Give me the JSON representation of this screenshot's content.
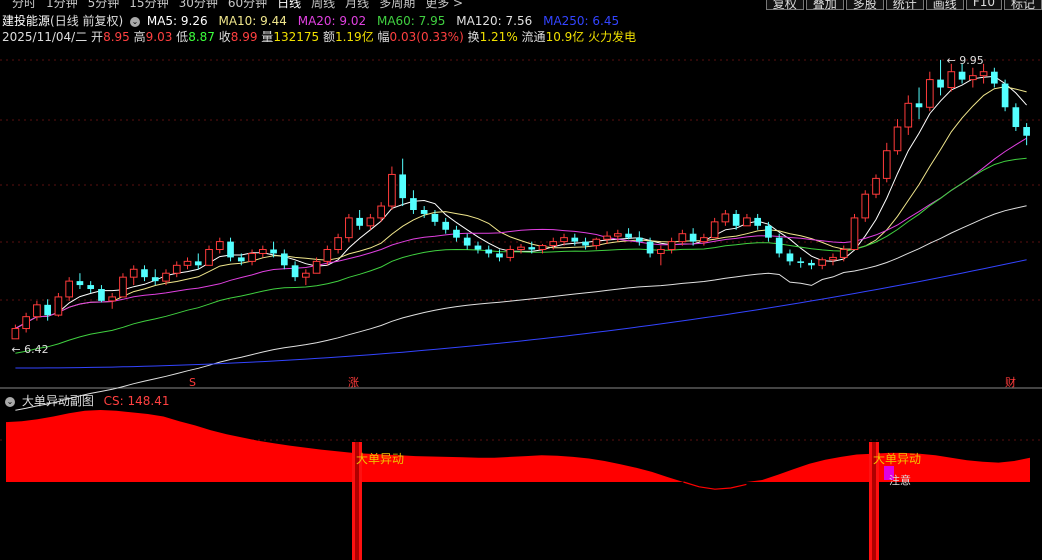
{
  "nav": {
    "periods": [
      "分时",
      "1分钟",
      "5分钟",
      "15分钟",
      "30分钟",
      "60分钟",
      "日线",
      "周线",
      "月线",
      "多周期",
      "更多 >"
    ],
    "selected_period": "日线",
    "buttons": [
      "复权",
      "叠加",
      "多股",
      "统计",
      "画线",
      "F10",
      "标记"
    ]
  },
  "stock": {
    "name": "建投能源",
    "mode": "(日线 前复权)",
    "date": "2025/11/04/二",
    "open_label": "开",
    "open": "8.95",
    "high_label": "高",
    "high": "9.03",
    "low_label": "低",
    "low": "8.87",
    "close_label": "收",
    "close": "8.99",
    "volume_label": "量",
    "volume": "132175",
    "amount_label": "额",
    "amount": "1.19亿",
    "change_label": "幅",
    "change": "0.03(0.33%)",
    "turnover_label": "换",
    "turnover": "1.21%",
    "float_label": "流通",
    "float": "10.9亿",
    "sector": "火力发电"
  },
  "ma": [
    {
      "label": "MA5: 9.26",
      "color": "#ffffff"
    },
    {
      "label": "MA10: 9.44",
      "color": "#f0e68c"
    },
    {
      "label": "MA20: 9.02",
      "color": "#e040e0"
    },
    {
      "label": "MA60: 7.95",
      "color": "#40d040"
    },
    {
      "label": "MA120: 7.56",
      "color": "#e0e0e0"
    },
    {
      "label": "MA250: 6.45",
      "color": "#3344ff"
    }
  ],
  "annotations": {
    "high": "9.95",
    "low": "6.42",
    "marker_s": "S",
    "marker_zhang": "涨",
    "marker_cai": "财"
  },
  "indicator": {
    "name": "大单异动副图",
    "value_label": "CS: 148.41",
    "signal": "大单异动",
    "attention": "注意"
  },
  "colors": {
    "up": "#ff3b3b",
    "down": "#54ffff",
    "ma5": "#ffffff",
    "ma10": "#f0e68c",
    "ma20": "#e040e0",
    "ma60": "#40d040",
    "ma120": "#e0e0e0",
    "ma250": "#3344ff",
    "fill": "#ff0000"
  },
  "chart_data": {
    "type": "candlestick",
    "x_label": "",
    "y_label": "",
    "ylim": [
      6.0,
      10.1
    ],
    "grid": true,
    "candles": [
      {
        "o": 6.42,
        "h": 6.6,
        "l": 6.42,
        "c": 6.55
      },
      {
        "o": 6.55,
        "h": 6.75,
        "l": 6.5,
        "c": 6.7
      },
      {
        "o": 6.7,
        "h": 6.9,
        "l": 6.65,
        "c": 6.85
      },
      {
        "o": 6.85,
        "h": 6.92,
        "l": 6.65,
        "c": 6.72
      },
      {
        "o": 6.72,
        "h": 7.0,
        "l": 6.7,
        "c": 6.95
      },
      {
        "o": 6.95,
        "h": 7.2,
        "l": 6.9,
        "c": 7.15
      },
      {
        "o": 7.15,
        "h": 7.25,
        "l": 7.05,
        "c": 7.1
      },
      {
        "o": 7.1,
        "h": 7.15,
        "l": 7.0,
        "c": 7.05
      },
      {
        "o": 7.05,
        "h": 7.1,
        "l": 6.88,
        "c": 6.9
      },
      {
        "o": 6.9,
        "h": 7.0,
        "l": 6.8,
        "c": 6.95
      },
      {
        "o": 6.95,
        "h": 7.25,
        "l": 6.95,
        "c": 7.2
      },
      {
        "o": 7.2,
        "h": 7.35,
        "l": 7.1,
        "c": 7.3
      },
      {
        "o": 7.3,
        "h": 7.35,
        "l": 7.15,
        "c": 7.2
      },
      {
        "o": 7.2,
        "h": 7.3,
        "l": 7.1,
        "c": 7.15
      },
      {
        "o": 7.15,
        "h": 7.3,
        "l": 7.1,
        "c": 7.25
      },
      {
        "o": 7.25,
        "h": 7.4,
        "l": 7.2,
        "c": 7.35
      },
      {
        "o": 7.35,
        "h": 7.45,
        "l": 7.3,
        "c": 7.4
      },
      {
        "o": 7.4,
        "h": 7.5,
        "l": 7.3,
        "c": 7.35
      },
      {
        "o": 7.35,
        "h": 7.6,
        "l": 7.35,
        "c": 7.55
      },
      {
        "o": 7.55,
        "h": 7.7,
        "l": 7.5,
        "c": 7.65
      },
      {
        "o": 7.65,
        "h": 7.7,
        "l": 7.4,
        "c": 7.45
      },
      {
        "o": 7.45,
        "h": 7.5,
        "l": 7.35,
        "c": 7.4
      },
      {
        "o": 7.4,
        "h": 7.55,
        "l": 7.35,
        "c": 7.5
      },
      {
        "o": 7.5,
        "h": 7.6,
        "l": 7.45,
        "c": 7.55
      },
      {
        "o": 7.55,
        "h": 7.65,
        "l": 7.45,
        "c": 7.5
      },
      {
        "o": 7.5,
        "h": 7.55,
        "l": 7.3,
        "c": 7.35
      },
      {
        "o": 7.35,
        "h": 7.4,
        "l": 7.15,
        "c": 7.2
      },
      {
        "o": 7.2,
        "h": 7.3,
        "l": 7.1,
        "c": 7.25
      },
      {
        "o": 7.25,
        "h": 7.45,
        "l": 7.25,
        "c": 7.4
      },
      {
        "o": 7.4,
        "h": 7.6,
        "l": 7.35,
        "c": 7.55
      },
      {
        "o": 7.55,
        "h": 7.75,
        "l": 7.5,
        "c": 7.7
      },
      {
        "o": 7.7,
        "h": 8.0,
        "l": 7.65,
        "c": 7.95
      },
      {
        "o": 7.95,
        "h": 8.05,
        "l": 7.8,
        "c": 7.85
      },
      {
        "o": 7.85,
        "h": 8.0,
        "l": 7.8,
        "c": 7.95
      },
      {
        "o": 7.95,
        "h": 8.15,
        "l": 7.9,
        "c": 8.1
      },
      {
        "o": 8.1,
        "h": 8.6,
        "l": 8.05,
        "c": 8.5
      },
      {
        "o": 8.5,
        "h": 8.7,
        "l": 8.1,
        "c": 8.2
      },
      {
        "o": 8.2,
        "h": 8.3,
        "l": 8.0,
        "c": 8.05
      },
      {
        "o": 8.05,
        "h": 8.1,
        "l": 7.95,
        "c": 8.0
      },
      {
        "o": 8.0,
        "h": 8.05,
        "l": 7.85,
        "c": 7.9
      },
      {
        "o": 7.9,
        "h": 7.95,
        "l": 7.75,
        "c": 7.8
      },
      {
        "o": 7.8,
        "h": 7.85,
        "l": 7.65,
        "c": 7.7
      },
      {
        "o": 7.7,
        "h": 7.75,
        "l": 7.55,
        "c": 7.6
      },
      {
        "o": 7.6,
        "h": 7.65,
        "l": 7.5,
        "c": 7.55
      },
      {
        "o": 7.55,
        "h": 7.6,
        "l": 7.45,
        "c": 7.5
      },
      {
        "o": 7.5,
        "h": 7.55,
        "l": 7.4,
        "c": 7.45
      },
      {
        "o": 7.45,
        "h": 7.6,
        "l": 7.4,
        "c": 7.55
      },
      {
        "o": 7.55,
        "h": 7.62,
        "l": 7.5,
        "c": 7.58
      },
      {
        "o": 7.58,
        "h": 7.65,
        "l": 7.5,
        "c": 7.55
      },
      {
        "o": 7.55,
        "h": 7.62,
        "l": 7.5,
        "c": 7.6
      },
      {
        "o": 7.6,
        "h": 7.7,
        "l": 7.55,
        "c": 7.65
      },
      {
        "o": 7.65,
        "h": 7.75,
        "l": 7.6,
        "c": 7.7
      },
      {
        "o": 7.7,
        "h": 7.75,
        "l": 7.6,
        "c": 7.65
      },
      {
        "o": 7.65,
        "h": 7.7,
        "l": 7.55,
        "c": 7.6
      },
      {
        "o": 7.6,
        "h": 7.7,
        "l": 7.55,
        "c": 7.68
      },
      {
        "o": 7.68,
        "h": 7.78,
        "l": 7.62,
        "c": 7.72
      },
      {
        "o": 7.72,
        "h": 7.8,
        "l": 7.65,
        "c": 7.75
      },
      {
        "o": 7.75,
        "h": 7.82,
        "l": 7.68,
        "c": 7.7
      },
      {
        "o": 7.7,
        "h": 7.78,
        "l": 7.6,
        "c": 7.65
      },
      {
        "o": 7.65,
        "h": 7.7,
        "l": 7.45,
        "c": 7.5
      },
      {
        "o": 7.5,
        "h": 7.6,
        "l": 7.35,
        "c": 7.55
      },
      {
        "o": 7.55,
        "h": 7.7,
        "l": 7.5,
        "c": 7.65
      },
      {
        "o": 7.65,
        "h": 7.8,
        "l": 7.6,
        "c": 7.75
      },
      {
        "o": 7.75,
        "h": 7.82,
        "l": 7.6,
        "c": 7.65
      },
      {
        "o": 7.65,
        "h": 7.75,
        "l": 7.6,
        "c": 7.7
      },
      {
        "o": 7.7,
        "h": 7.95,
        "l": 7.7,
        "c": 7.9
      },
      {
        "o": 7.9,
        "h": 8.05,
        "l": 7.85,
        "c": 8.0
      },
      {
        "o": 8.0,
        "h": 8.05,
        "l": 7.8,
        "c": 7.85
      },
      {
        "o": 7.85,
        "h": 8.0,
        "l": 7.85,
        "c": 7.95
      },
      {
        "o": 7.95,
        "h": 8.0,
        "l": 7.8,
        "c": 7.85
      },
      {
        "o": 7.85,
        "h": 7.9,
        "l": 7.65,
        "c": 7.7
      },
      {
        "o": 7.7,
        "h": 7.75,
        "l": 7.45,
        "c": 7.5
      },
      {
        "o": 7.5,
        "h": 7.55,
        "l": 7.35,
        "c": 7.4
      },
      {
        "o": 7.4,
        "h": 7.45,
        "l": 7.32,
        "c": 7.38
      },
      {
        "o": 7.38,
        "h": 7.42,
        "l": 7.3,
        "c": 7.35
      },
      {
        "o": 7.35,
        "h": 7.45,
        "l": 7.3,
        "c": 7.42
      },
      {
        "o": 7.42,
        "h": 7.5,
        "l": 7.35,
        "c": 7.45
      },
      {
        "o": 7.45,
        "h": 7.6,
        "l": 7.4,
        "c": 7.55
      },
      {
        "o": 7.55,
        "h": 8.0,
        "l": 7.55,
        "c": 7.95
      },
      {
        "o": 7.95,
        "h": 8.3,
        "l": 7.9,
        "c": 8.25
      },
      {
        "o": 8.25,
        "h": 8.5,
        "l": 8.2,
        "c": 8.45
      },
      {
        "o": 8.45,
        "h": 8.9,
        "l": 8.4,
        "c": 8.8
      },
      {
        "o": 8.8,
        "h": 9.2,
        "l": 8.75,
        "c": 9.1
      },
      {
        "o": 9.1,
        "h": 9.5,
        "l": 9.0,
        "c": 9.4
      },
      {
        "o": 9.4,
        "h": 9.6,
        "l": 9.2,
        "c": 9.35
      },
      {
        "o": 9.35,
        "h": 9.8,
        "l": 9.3,
        "c": 9.7
      },
      {
        "o": 9.7,
        "h": 9.95,
        "l": 9.5,
        "c": 9.6
      },
      {
        "o": 9.6,
        "h": 9.9,
        "l": 9.55,
        "c": 9.8
      },
      {
        "o": 9.8,
        "h": 9.9,
        "l": 9.65,
        "c": 9.7
      },
      {
        "o": 9.7,
        "h": 9.85,
        "l": 9.6,
        "c": 9.75
      },
      {
        "o": 9.75,
        "h": 9.9,
        "l": 9.65,
        "c": 9.8
      },
      {
        "o": 9.8,
        "h": 9.85,
        "l": 9.6,
        "c": 9.65
      },
      {
        "o": 9.65,
        "h": 9.7,
        "l": 9.3,
        "c": 9.35
      },
      {
        "o": 9.35,
        "h": 9.4,
        "l": 9.05,
        "c": 9.1
      },
      {
        "o": 9.1,
        "h": 9.15,
        "l": 8.87,
        "c": 8.99
      }
    ],
    "indicator_series": [
      {
        "name": "CS",
        "values": [
          148,
          150,
          155,
          162,
          170,
          176,
          178,
          176,
          172,
          168,
          162,
          150,
          140,
          128,
          118,
          110,
          102,
          96,
          90,
          85,
          80,
          76,
          72,
          70,
          68,
          66,
          64,
          63,
          62,
          61,
          60,
          60,
          62,
          64,
          66,
          65,
          62,
          58,
          52,
          44,
          35,
          25,
          12,
          0,
          -8,
          -12,
          -10,
          -4,
          5,
          18,
          32,
          45,
          55,
          62,
          68,
          70,
          72,
          72,
          70,
          66,
          60,
          54,
          50,
          48,
          52,
          60
        ]
      }
    ]
  }
}
